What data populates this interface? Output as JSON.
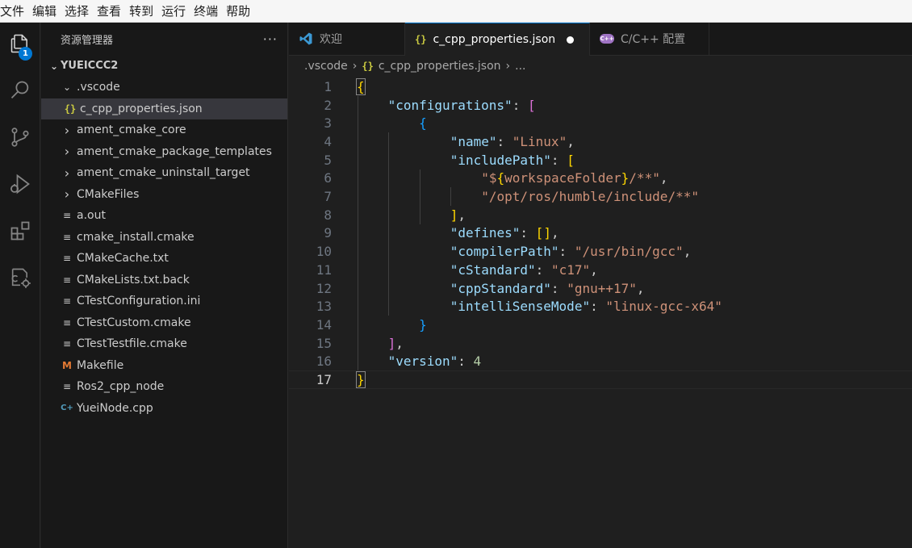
{
  "menu": [
    "文件",
    "编辑",
    "选择",
    "查看",
    "转到",
    "运行",
    "终端",
    "帮助"
  ],
  "activity": {
    "explorer_badge": "1",
    "icons": [
      "files-icon",
      "search-icon",
      "source-control-icon",
      "run-debug-icon",
      "extensions-icon",
      "cmake-icon"
    ]
  },
  "sidebar": {
    "title": "资源管理器",
    "more": "···",
    "root": "YUEICCC2",
    "items": [
      {
        "label": ".vscode",
        "type": "folder-open",
        "indent": 1
      },
      {
        "label": "c_cpp_properties.json",
        "type": "json",
        "indent": 2,
        "selected": true
      },
      {
        "label": "ament_cmake_core",
        "type": "folder",
        "indent": 1
      },
      {
        "label": "ament_cmake_package_templates",
        "type": "folder",
        "indent": 1
      },
      {
        "label": "ament_cmake_uninstall_target",
        "type": "folder",
        "indent": 1
      },
      {
        "label": "CMakeFiles",
        "type": "folder",
        "indent": 1
      },
      {
        "label": "a.out",
        "type": "file",
        "indent": 1
      },
      {
        "label": "cmake_install.cmake",
        "type": "file",
        "indent": 1
      },
      {
        "label": "CMakeCache.txt",
        "type": "file",
        "indent": 1
      },
      {
        "label": "CMakeLists.txt.back",
        "type": "file",
        "indent": 1
      },
      {
        "label": "CTestConfiguration.ini",
        "type": "file",
        "indent": 1
      },
      {
        "label": "CTestCustom.cmake",
        "type": "file",
        "indent": 1
      },
      {
        "label": "CTestTestfile.cmake",
        "type": "file",
        "indent": 1
      },
      {
        "label": "Makefile",
        "type": "makefile",
        "indent": 1
      },
      {
        "label": "Ros2_cpp_node",
        "type": "file",
        "indent": 1
      },
      {
        "label": "YueiNode.cpp",
        "type": "cpp",
        "indent": 1
      }
    ]
  },
  "tabs": [
    {
      "label": "欢迎",
      "icon": "vscode-icon",
      "active": false
    },
    {
      "label": "c_cpp_properties.json",
      "icon": "json-icon",
      "active": true,
      "modified": true
    },
    {
      "label": "C/C++ 配置",
      "icon": "cpp-config-icon",
      "active": false
    }
  ],
  "breadcrumb": [
    ".vscode",
    "c_cpp_properties.json",
    "..."
  ],
  "editor": {
    "current_line": 17,
    "lines": [
      "{",
      "    \"configurations\": [",
      "        {",
      "            \"name\": \"Linux\",",
      "            \"includePath\": [",
      "                \"${workspaceFolder}/**\",",
      "                \"/opt/ros/humble/include/**\"",
      "            ],",
      "            \"defines\": [],",
      "            \"compilerPath\": \"/usr/bin/gcc\",",
      "            \"cStandard\": \"c17\",",
      "            \"cppStandard\": \"gnu++17\",",
      "            \"intelliSenseMode\": \"linux-gcc-x64\"",
      "        }",
      "    ],",
      "    \"version\": 4",
      "}"
    ]
  },
  "colors": {
    "accent": "#0078d4",
    "json_key": "#9cdcfe",
    "json_string": "#ce9178",
    "json_number": "#b5cea8"
  }
}
